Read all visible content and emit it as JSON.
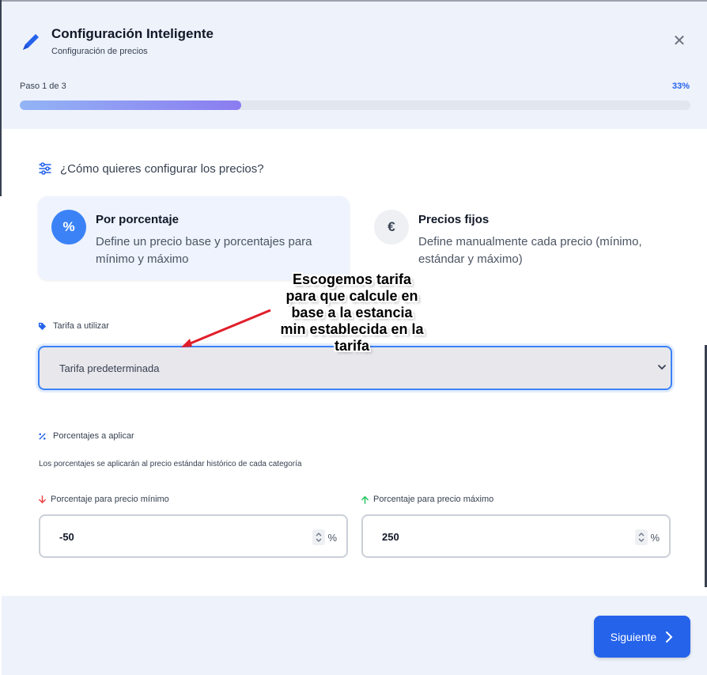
{
  "header": {
    "title": "Configuración Inteligente",
    "subtitle": "Configuración de precios",
    "step_label": "Paso 1 de 3",
    "progress_label": "33%",
    "progress_fraction": 0.33,
    "close_glyph": "✕"
  },
  "question": "¿Cómo quieres configurar los precios?",
  "options": [
    {
      "icon": "percent-icon",
      "glyph": "%",
      "title": "Por porcentaje",
      "description": "Define un precio base y porcentajes para mínimo y máximo",
      "selected": true
    },
    {
      "icon": "euro-icon",
      "glyph": "€",
      "title": "Precios fijos",
      "description": "Define manualmente cada precio (mínimo, estándar y máximo)",
      "selected": false
    }
  ],
  "rate": {
    "label": "Tarifa a utilizar",
    "selected_value": "Tarifa predeterminada"
  },
  "percentages": {
    "label": "Porcentajes a aplicar",
    "help": "Los porcentajes se aplicarán al precio estándar histórico de cada categoría",
    "min": {
      "label": "Porcentaje para precio mínimo",
      "value": "-50",
      "unit": "%"
    },
    "max": {
      "label": "Porcentaje para precio máximo",
      "value": "250",
      "unit": "%"
    }
  },
  "footer": {
    "next_label": "Siguiente"
  },
  "annotation": {
    "lines": [
      "Escogemos tarifa",
      "para que calcule en",
      "base a la estancia",
      "min establecida en la",
      "tarifa"
    ]
  },
  "colors": {
    "accent": "#2563eb",
    "down": "#ef4444",
    "up": "#22c55e",
    "annotation_arrow": "#e11d2a"
  }
}
